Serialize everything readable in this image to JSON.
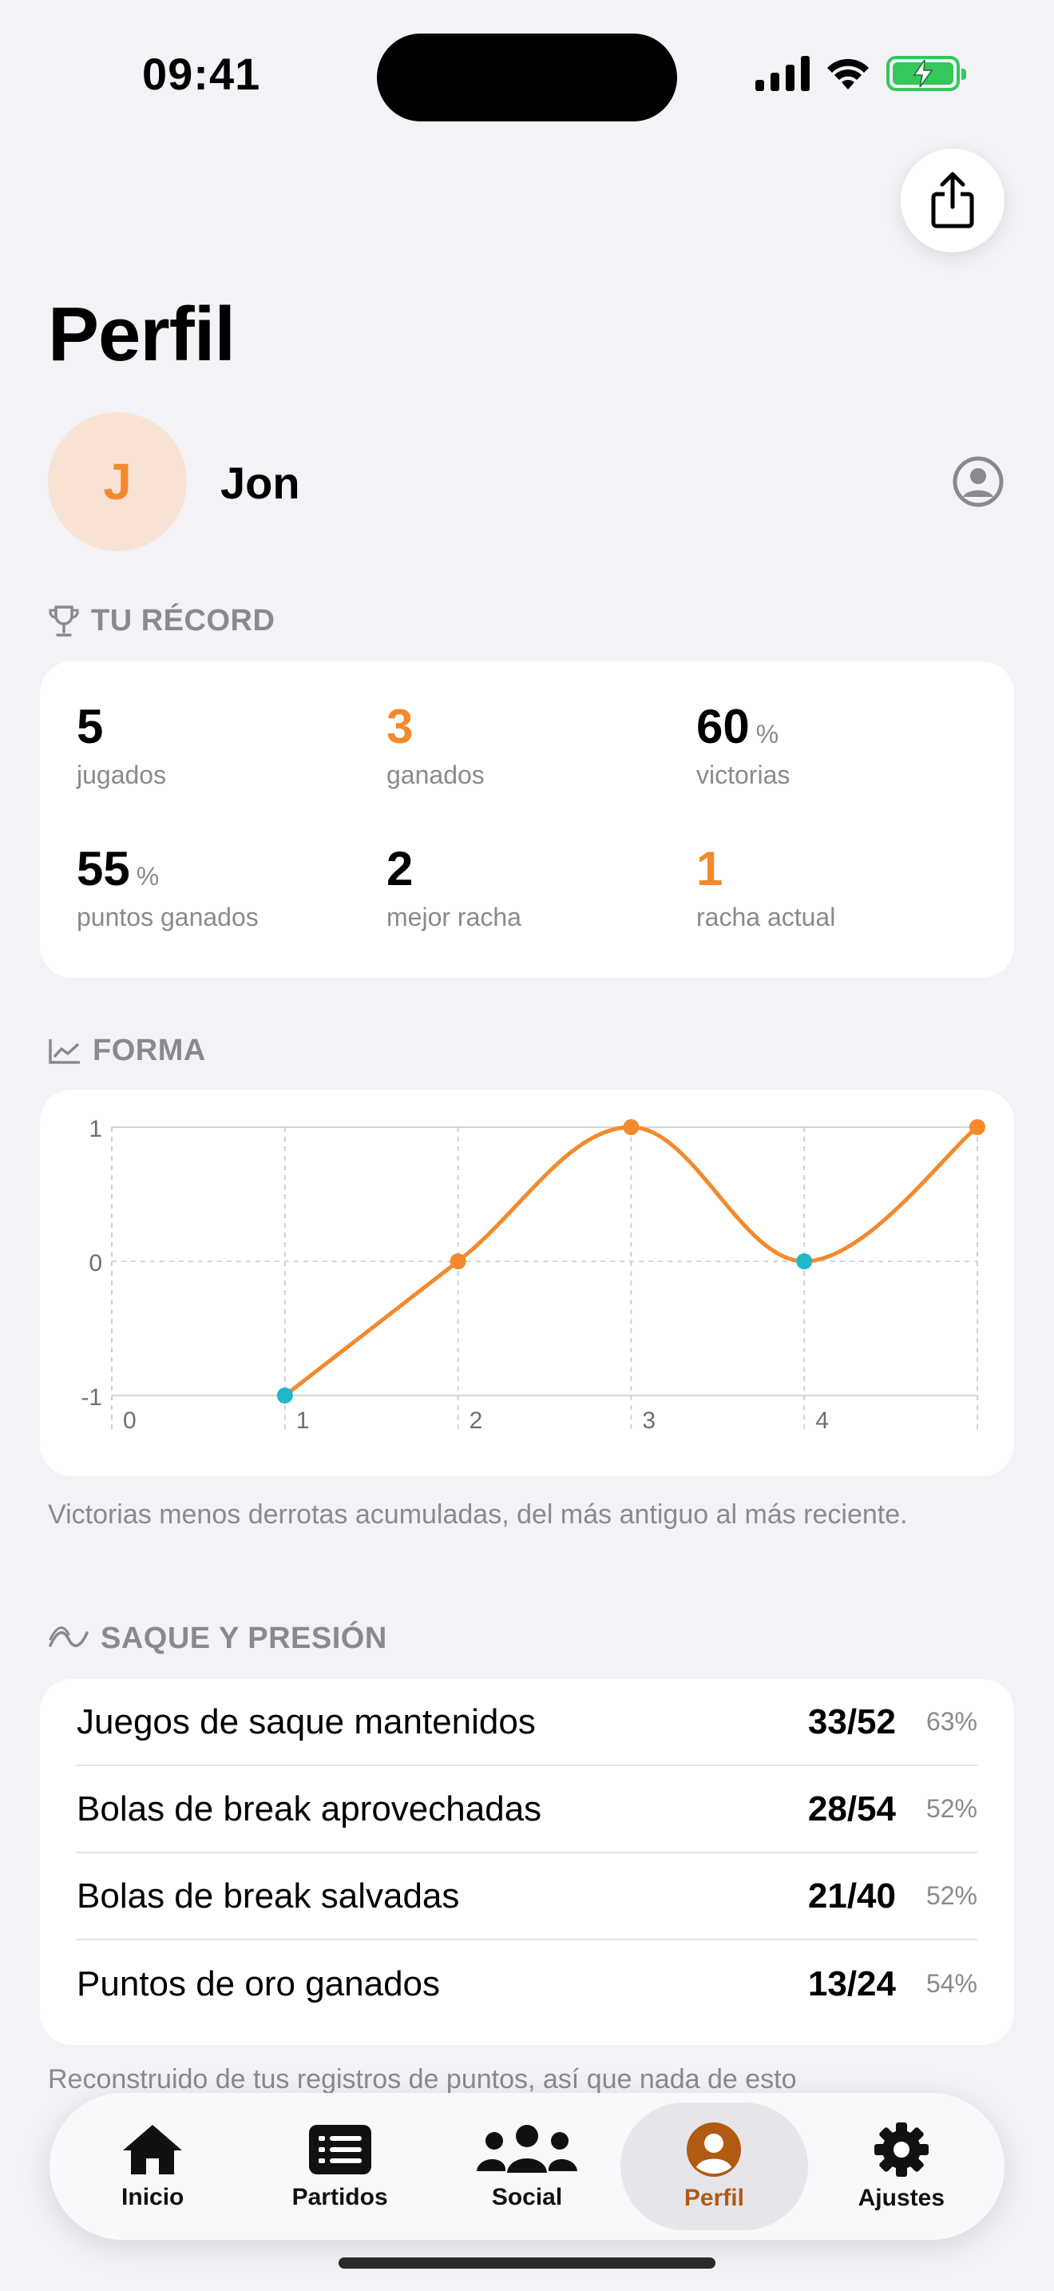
{
  "status_bar": {
    "time": "09:41"
  },
  "page": {
    "title": "Perfil"
  },
  "profile": {
    "initial": "J",
    "name": "Jon"
  },
  "record": {
    "header": "TU RÉCORD",
    "stats": [
      {
        "value": "5",
        "unit": "",
        "label": "jugados",
        "highlight": false
      },
      {
        "value": "3",
        "unit": "",
        "label": "ganados",
        "highlight": true
      },
      {
        "value": "60",
        "unit": "%",
        "label": "victorias",
        "highlight": false
      },
      {
        "value": "55",
        "unit": "%",
        "label": "puntos ganados",
        "highlight": false
      },
      {
        "value": "2",
        "unit": "",
        "label": "mejor racha",
        "highlight": false
      },
      {
        "value": "1",
        "unit": "",
        "label": "racha actual",
        "highlight": true
      }
    ]
  },
  "form": {
    "header": "FORMA",
    "caption": "Victorias menos derrotas acumuladas, del más antiguo al más reciente."
  },
  "chart_data": {
    "type": "line",
    "title": "",
    "xlabel": "",
    "ylabel": "",
    "x": [
      1,
      2,
      3,
      4,
      5
    ],
    "x_tick_labels": [
      "0",
      "1",
      "2",
      "3",
      "4"
    ],
    "y_tick_labels": [
      "1",
      "0",
      "-1"
    ],
    "xlim": [
      0,
      5
    ],
    "ylim": [
      -1,
      1
    ],
    "grid": true,
    "series": [
      {
        "values": [
          -1,
          0,
          1,
          0,
          1
        ]
      }
    ],
    "point_colors": [
      "#1FB8C9",
      "#F28A2C",
      "#F28A2C",
      "#1FB8C9",
      "#F28A2C"
    ],
    "line_color": "#F28A2C"
  },
  "serve": {
    "header": "SAQUE Y PRESIÓN",
    "rows": [
      {
        "label": "Juegos de saque mantenidos",
        "fraction": "33/52",
        "percent": "63%"
      },
      {
        "label": "Bolas de break aprovechadas",
        "fraction": "28/54",
        "percent": "52%"
      },
      {
        "label": "Bolas de break salvadas",
        "fraction": "21/40",
        "percent": "52%"
      },
      {
        "label": "Puntos de oro ganados",
        "fraction": "13/24",
        "percent": "54%"
      }
    ],
    "footer": "Reconstruido de tus registros de puntos, así que nada de esto"
  },
  "tabbar": {
    "tabs": [
      {
        "label": "Inicio",
        "icon": "house-icon"
      },
      {
        "label": "Partidos",
        "icon": "list-icon"
      },
      {
        "label": "Social",
        "icon": "people-icon"
      },
      {
        "label": "Perfil",
        "icon": "person-icon"
      },
      {
        "label": "Ajustes",
        "icon": "gear-icon"
      }
    ],
    "active": "Perfil"
  },
  "colors": {
    "accent": "#F28A2C",
    "teal": "#1FB8C9",
    "background": "#F2F2F7",
    "active_tab": "#B05A12"
  }
}
